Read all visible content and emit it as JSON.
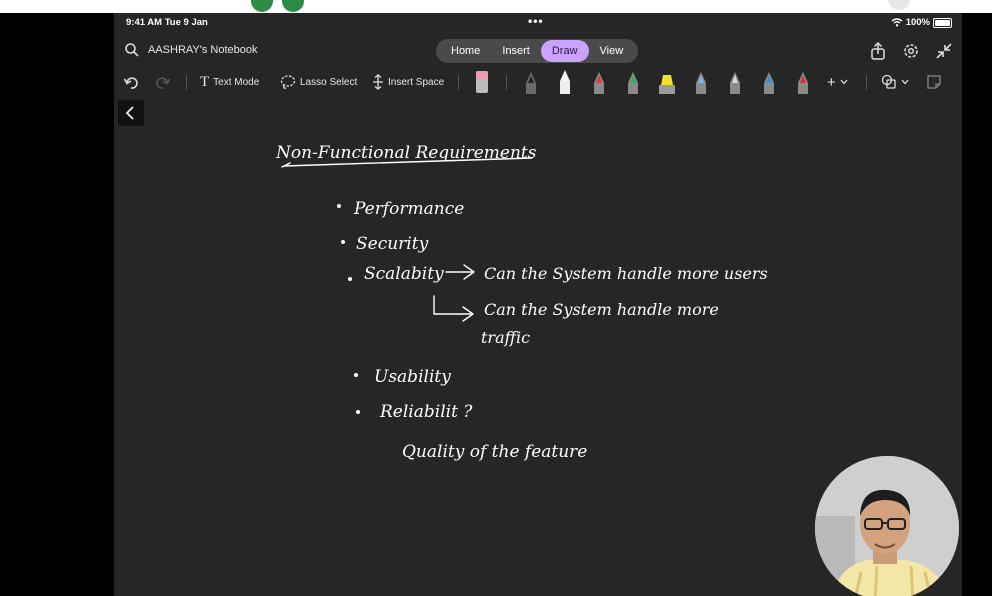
{
  "status": {
    "time": "9:41 AM  Tue 9 Jan",
    "more": "•••",
    "battery": "100%"
  },
  "header": {
    "notebook": "AASHRAY's Notebook",
    "tabs": [
      "Home",
      "Insert",
      "Draw",
      "View"
    ],
    "active_tab": "Draw"
  },
  "toolbar": {
    "text_mode": "Text Mode",
    "lasso": "Lasso Select",
    "insert_space": "Insert Space",
    "add": "+"
  },
  "colors": {
    "accent": "#c9a3ff",
    "canvas": "#262626",
    "ink": "#ffffff"
  },
  "notes": {
    "title": "Non-Functional Requirements",
    "b1": "Performance",
    "b2": "Security",
    "b3": "Scalabity",
    "b3a": "Can the System handle more users",
    "b3b1": "Can the System handle more",
    "b3b2": "traffic",
    "b4": "Usability",
    "b5": "Reliabilit ?",
    "b5a": "Quality of the feature"
  }
}
